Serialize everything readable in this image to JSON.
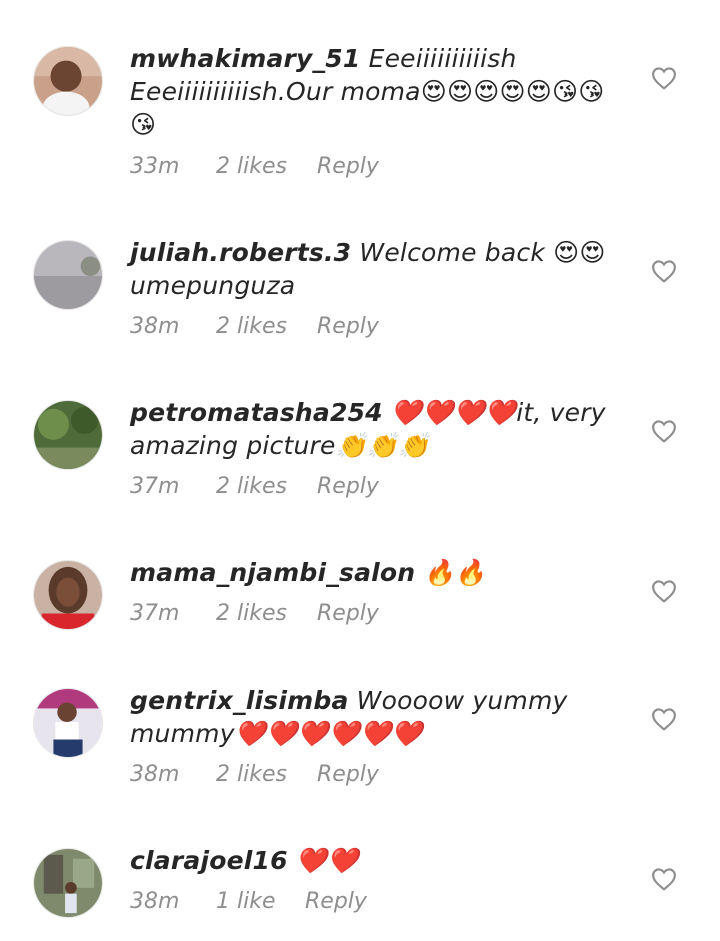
{
  "comments": [
    {
      "username": "mwhakimary_51",
      "text": " Eeeiiiiiiiiiish Eeeiiiiiiiiiish.Our moma😍😍😍😍😍😘😘😘",
      "time": "33m",
      "likes": "2 likes",
      "reply": "Reply"
    },
    {
      "username": "juliah.roberts.3",
      "text": " Welcome back 😍😍 umepunguza",
      "time": "38m",
      "likes": "2 likes",
      "reply": "Reply"
    },
    {
      "username": "petromatasha254",
      "text": " ❤️❤️❤️❤️it, very amazing picture👏👏👏",
      "time": "37m",
      "likes": "2 likes",
      "reply": "Reply"
    },
    {
      "username": "mama_njambi_salon",
      "text": " 🔥🔥",
      "time": "37m",
      "likes": "2 likes",
      "reply": "Reply"
    },
    {
      "username": "gentrix_lisimba",
      "text": " Woooow yummy mummy❤️❤️❤️❤️❤️❤️",
      "time": "38m",
      "likes": "2 likes",
      "reply": "Reply"
    },
    {
      "username": "clarajoel16",
      "text": " ❤️❤️",
      "time": "38m",
      "likes": "1 like",
      "reply": "Reply"
    }
  ],
  "icons": {
    "like": "heart-outline-icon"
  },
  "colors": {
    "text": "#262626",
    "meta": "#8e8e8e",
    "icon": "#8e8e8e"
  }
}
